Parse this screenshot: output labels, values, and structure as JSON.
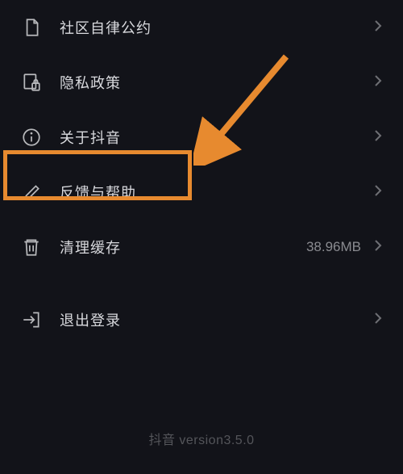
{
  "settings": {
    "items": [
      {
        "id": "community-rules",
        "icon": "document-icon",
        "label": "社区自律公约",
        "meta": ""
      },
      {
        "id": "privacy-policy",
        "icon": "privacy-icon",
        "label": "隐私政策",
        "meta": ""
      },
      {
        "id": "about",
        "icon": "info-icon",
        "label": "关于抖音",
        "meta": ""
      },
      {
        "id": "feedback-help",
        "icon": "edit-icon",
        "label": "反馈与帮助",
        "meta": ""
      },
      {
        "id": "clear-cache",
        "icon": "trash-icon",
        "label": "清理缓存",
        "meta": "38.96MB"
      },
      {
        "id": "logout",
        "icon": "logout-icon",
        "label": "退出登录",
        "meta": ""
      }
    ]
  },
  "footer": {
    "version": "抖音 version3.5.0"
  },
  "annotation": {
    "highlighted_item": "feedback-help",
    "arrow_color": "#e78a2f"
  }
}
